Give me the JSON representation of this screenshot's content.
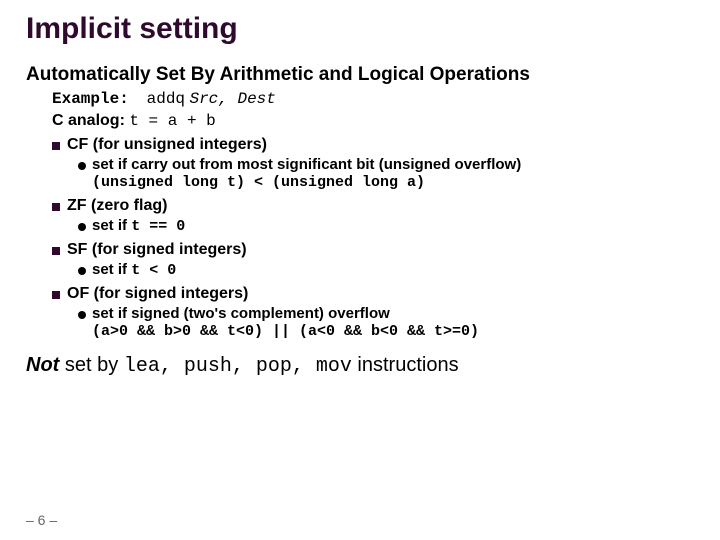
{
  "title": "Implicit setting",
  "subhead": "Automatically Set By Arithmetic and Logical Operations",
  "example_label": "Example:",
  "example_instr": "addq",
  "example_args": "Src, Dest",
  "canalog_label": "C analog:",
  "canalog_code": "t = a + b",
  "flags": [
    {
      "name": "CF",
      "desc": "(for unsigned integers)",
      "set_text": "set if carry out from most significant bit (unsigned overflow)",
      "code": "(unsigned long t) < (unsigned long a)"
    },
    {
      "name": "ZF",
      "desc": "(zero flag)",
      "set_text": "set if ",
      "inline_code": "t == 0"
    },
    {
      "name": "SF",
      "desc": "(for signed integers)",
      "set_text": "set if ",
      "inline_code": "t < 0"
    },
    {
      "name": "OF",
      "desc": "(for signed integers)",
      "set_text": "set if signed (two's complement) overflow",
      "code": "(a>0 && b>0 && t<0) || (a<0 && b<0 && t>=0)"
    }
  ],
  "notset_lead": "Not",
  "notset_mid": " set by ",
  "notset_code": "lea, push, pop, mov",
  "notset_tail": "  instructions",
  "pagenum": "– 6 –"
}
